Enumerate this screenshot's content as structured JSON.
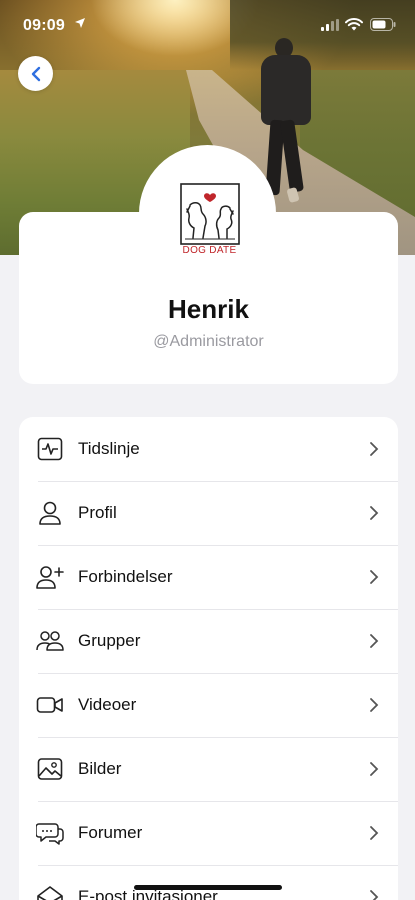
{
  "status_bar": {
    "time": "09:09"
  },
  "profile": {
    "logo_text": "DOG DATE",
    "name": "Henrik",
    "handle": "@Administrator"
  },
  "menu": {
    "items": [
      {
        "label": "Tidslinje",
        "icon": "activity-icon"
      },
      {
        "label": "Profil",
        "icon": "user-icon"
      },
      {
        "label": "Forbindelser",
        "icon": "add-user-icon"
      },
      {
        "label": "Grupper",
        "icon": "group-icon"
      },
      {
        "label": "Videoer",
        "icon": "video-icon"
      },
      {
        "label": "Bilder",
        "icon": "image-icon"
      },
      {
        "label": "Forumer",
        "icon": "forum-icon"
      },
      {
        "label": "E-post invitasjoner",
        "icon": "mail-icon"
      }
    ]
  },
  "colors": {
    "brand_red": "#c0262b",
    "back_blue": "#2f6fe0"
  }
}
